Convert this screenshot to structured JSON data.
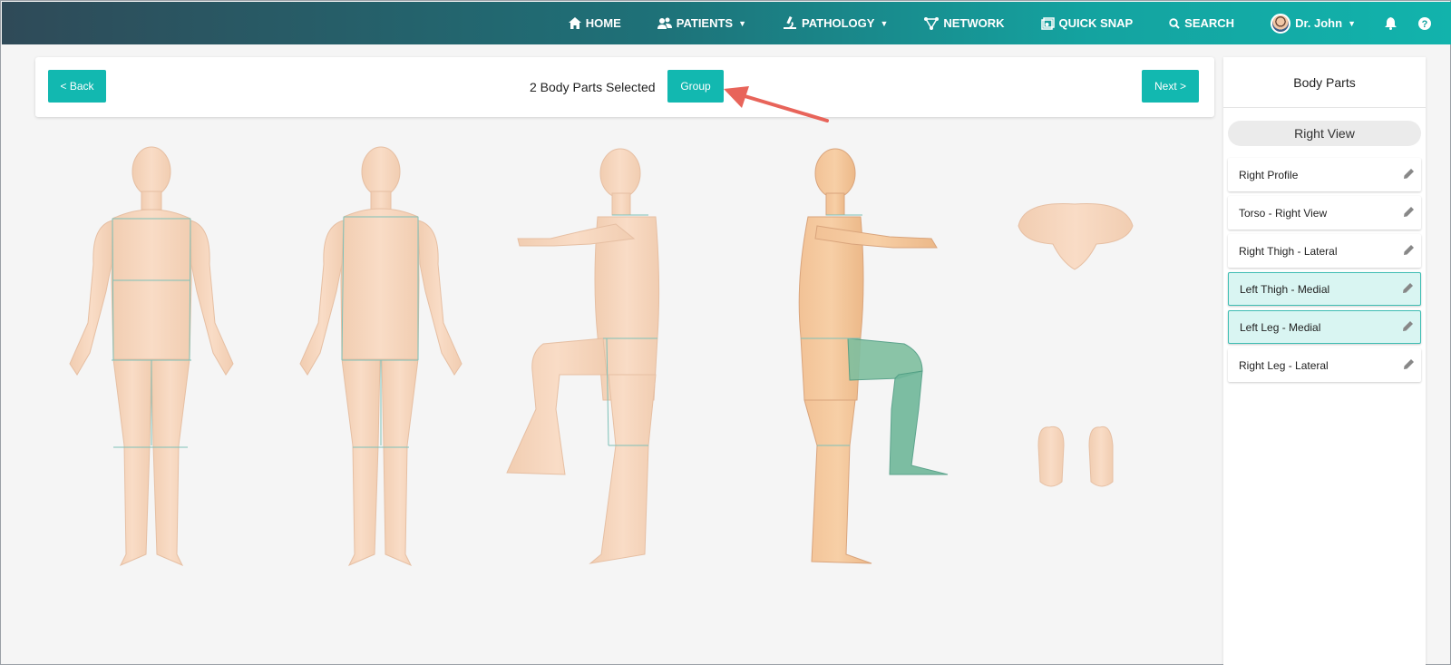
{
  "nav": {
    "home": "HOME",
    "patients": "PATIENTS",
    "pathology": "PATHOLOGY",
    "network": "NETWORK",
    "quick_snap": "QUICK SNAP",
    "search": "SEARCH",
    "user": "Dr. John",
    "icons": [
      "home-icon",
      "patients-icon",
      "pathology-icon",
      "network-icon",
      "quick-snap-icon",
      "search-icon",
      "bell-icon",
      "help-icon"
    ]
  },
  "toolbar": {
    "back_label": "< Back",
    "selection_text": "2 Body Parts Selected",
    "group_label": "Group",
    "next_label": "Next >"
  },
  "panel": {
    "title": "Body Parts",
    "view": "Right View",
    "items": [
      {
        "label": "Right Profile",
        "selected": false
      },
      {
        "label": "Torso - Right View",
        "selected": false
      },
      {
        "label": "Right Thigh - Lateral",
        "selected": false
      },
      {
        "label": "Left Thigh - Medial",
        "selected": true
      },
      {
        "label": "Left Leg - Medial",
        "selected": true
      },
      {
        "label": "Right Leg - Lateral",
        "selected": false
      }
    ]
  },
  "colors": {
    "accent": "#12b8b0",
    "selected_bg": "#d9f5f2",
    "skin": "#f7d7bd",
    "highlight_region": "#6fb79a",
    "annotation_arrow": "#e8645a"
  }
}
